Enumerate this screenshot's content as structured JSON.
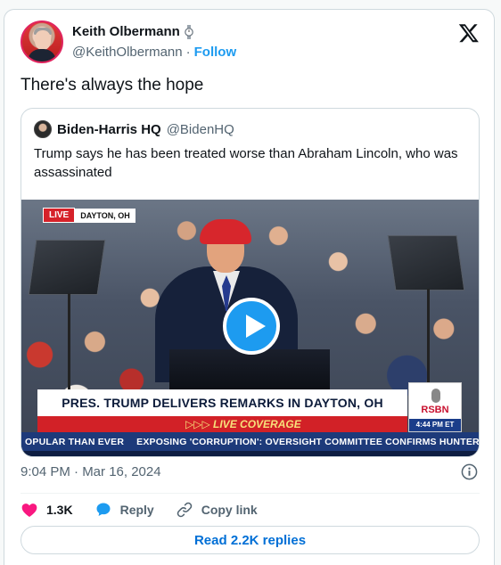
{
  "author": {
    "display_name": "Keith Olbermann",
    "handle": "@KeithOlbermann",
    "separator": "·",
    "follow_label": "Follow"
  },
  "tweet": {
    "text": "There's always the hope",
    "timestamp": "9:04 PM · Mar 16, 2024"
  },
  "quote": {
    "display_name": "Biden-Harris HQ",
    "handle": "@BidenHQ",
    "text": "Trump says he has been treated worse than Abraham Lincoln, who was assassinated"
  },
  "video": {
    "live_label": "LIVE",
    "location": "DAYTON, OH",
    "headline": "PRES. TRUMP DELIVERS REMARKS IN DAYTON, OH",
    "coverage": "▷▷▷ LIVE COVERAGE",
    "network": "RSBN",
    "network_time": "4:44 PM ET",
    "ticker_left": "OPULAR THAN EVER",
    "ticker_right": "EXPOSING 'CORRUPTION': OVERSIGHT COMMITTEE CONFIRMS HUNTER BIDE"
  },
  "actions": {
    "likes": "1.3K",
    "reply_label": "Reply",
    "copy_link_label": "Copy link",
    "read_replies_label": "Read 2.2K replies"
  },
  "colors": {
    "accent": "#1d9bf0",
    "like": "#f91880",
    "link": "#006fd6"
  }
}
